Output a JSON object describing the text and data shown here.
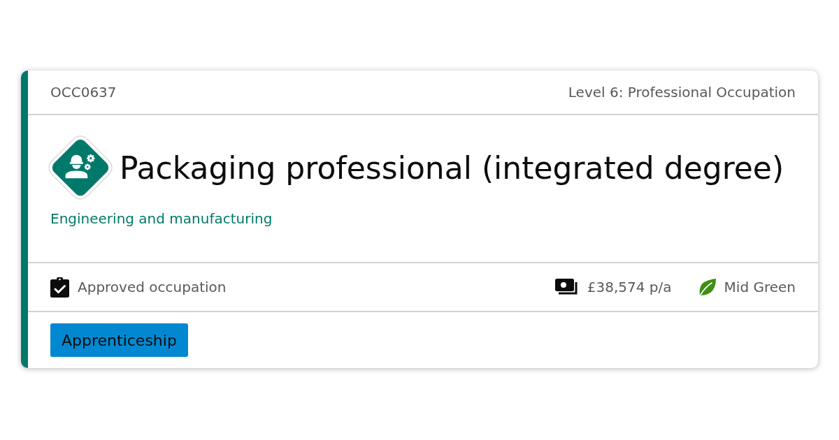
{
  "card": {
    "code": "OCC0637",
    "level": "Level 6: Professional Occupation",
    "title": "Packaging professional (integrated degree)",
    "route": "Engineering and manufacturing",
    "status": "Approved occupation",
    "facts": [
      {
        "kind": "salary",
        "text": "£38,574 p/a"
      },
      {
        "kind": "green",
        "text": "Mid Green"
      }
    ],
    "tags": [
      "Apprenticeship"
    ]
  }
}
